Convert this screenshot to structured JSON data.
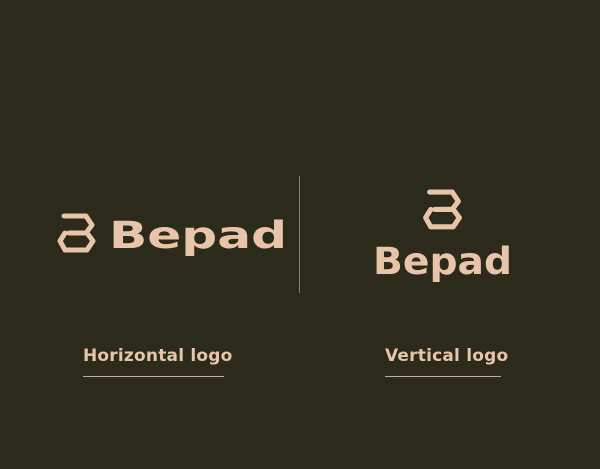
{
  "brand": {
    "name": "Bepad",
    "color": "#e8c4a8",
    "background": "#2b2a1b",
    "icon": "hexagonal-b-mark-icon"
  },
  "horizontal": {
    "caption": "Horizontal logo"
  },
  "vertical": {
    "caption": "Vertical logo"
  }
}
